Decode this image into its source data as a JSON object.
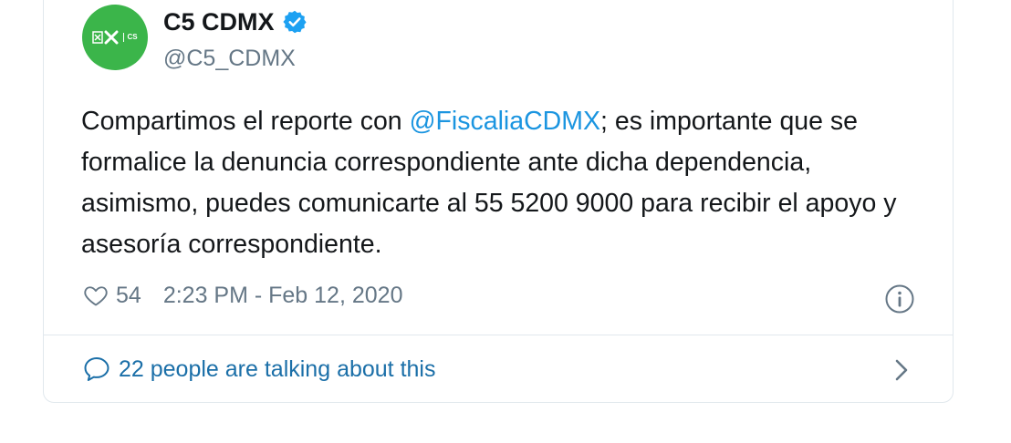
{
  "user": {
    "display_name": "C5 CDMX",
    "handle": "@C5_CDMX",
    "avatar_badge": "CS",
    "avatar_color": "#3bb54a",
    "verified": true
  },
  "tweet": {
    "text_before": "Compartimos el reporte con ",
    "mention": "@FiscaliaCDMX",
    "text_after": "; es importante que se formalice la denuncia correspondiente ante dicha dependencia, asimismo, puedes comunicarte al 55 5200 9000 para recibir el apoyo y asesoría correspondiente."
  },
  "meta": {
    "like_count": "54",
    "timestamp": "2:23 PM - Feb 12, 2020"
  },
  "conversation": {
    "label": "22 people are talking about this"
  },
  "colors": {
    "link": "#1b95e0",
    "muted": "#657786",
    "verified": "#1da1f2",
    "border": "#e1e8ed"
  }
}
